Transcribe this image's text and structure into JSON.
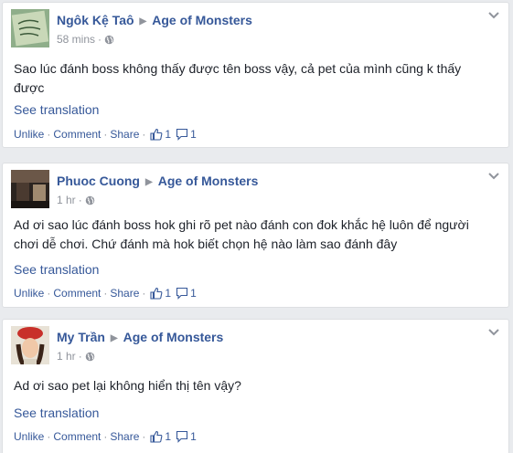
{
  "posts": [
    {
      "author": "Ngôk Kệ Taô",
      "group": "Age of Monsters",
      "time": "58 mins",
      "text": "Sao lúc đánh boss không thấy được tên boss vậy, cả pet của mình cũng k thấy được",
      "see_translation": "See translation",
      "actions": {
        "unlike": "Unlike",
        "comment": "Comment",
        "share": "Share",
        "likes": "1",
        "comments": "1"
      }
    },
    {
      "author": "Phuoc Cuong",
      "group": "Age of Monsters",
      "time": "1 hr",
      "text": "Ad ơi sao lúc đánh boss hok ghi rõ pet nào đánh con đok khắc hệ luôn để người chơi dễ chơi. Chứ đánh mà hok biết chọn hệ nào làm sao đánh đây",
      "see_translation": "See translation",
      "actions": {
        "unlike": "Unlike",
        "comment": "Comment",
        "share": "Share",
        "likes": "1",
        "comments": "1"
      }
    },
    {
      "author": "My Trần",
      "group": "Age of Monsters",
      "time": "1 hr",
      "text": "Ad ơi sao pet lại không hiển thị tên vậy?",
      "see_translation": "See translation",
      "actions": {
        "unlike": "Unlike",
        "comment": "Comment",
        "share": "Share",
        "likes": "1",
        "comments": "1"
      }
    }
  ]
}
